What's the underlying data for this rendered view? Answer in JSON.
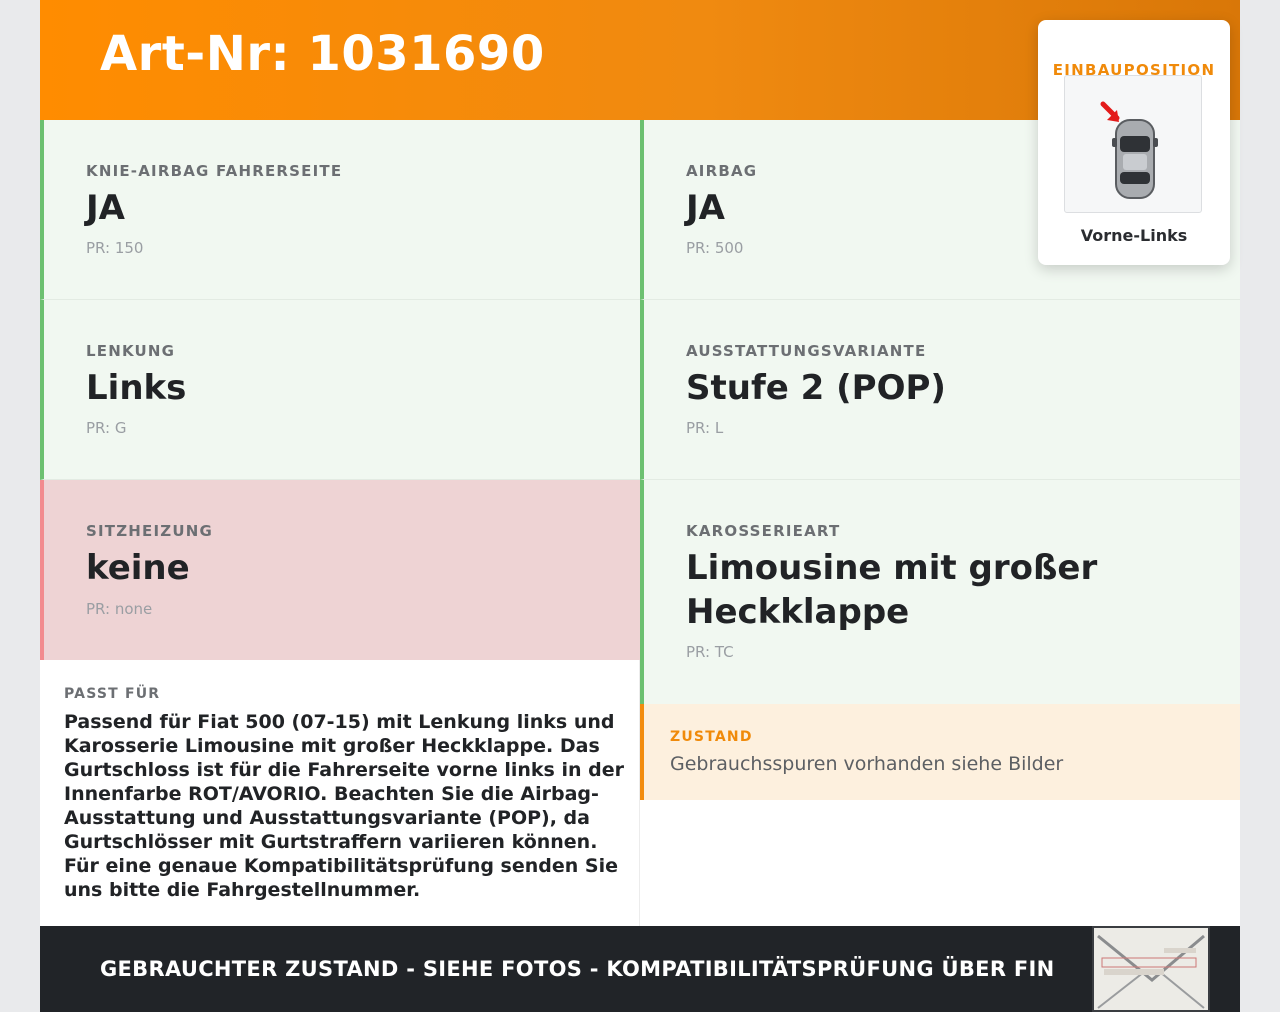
{
  "header": {
    "title": "Art-Nr: 1031690"
  },
  "cells": [
    {
      "label": "KNIE-AIRBAG FAHRERSEITE",
      "value": "JA",
      "pr": "PR: 150"
    },
    {
      "label": "AIRBAG",
      "value": "JA",
      "pr": "PR: 500"
    },
    {
      "label": "LENKUNG",
      "value": "Links",
      "pr": "PR: G"
    },
    {
      "label": "AUSSTATTUNGSVARIANTE",
      "value": "Stufe 2 (POP)",
      "pr": "PR: L"
    },
    {
      "label": "SITZHEIZUNG",
      "value": "keine",
      "pr": "PR: none"
    },
    {
      "label": "KAROSSERIEART",
      "value": "Limousine mit großer Heckklappe",
      "pr": "PR: TC"
    }
  ],
  "fits": {
    "label": "PASST FÜR",
    "text": "Passend für Fiat 500 (07-15) mit Lenkung links und Karosserie Limousine mit großer Heckklappe. Das Gurtschloss ist für die Fahrerseite vorne links in der Innenfarbe ROT/AVORIO. Beachten Sie die Airbag-Ausstattung und Ausstattungsvariante (POP), da Gurtschlösser mit Gurtstraffern variieren können. Für eine genaue Kompatibilitätsprüfung senden Sie uns bitte die Fahrgestellnummer."
  },
  "condition": {
    "label": "ZUSTAND",
    "text": "Gebrauchsspuren vorhanden siehe Bilder"
  },
  "position": {
    "title": "EINBAUPOSITION",
    "caption": "Vorne-Links"
  },
  "footer": {
    "text": "GEBRAUCHTER ZUSTAND - SIEHE FOTOS - KOMPATIBILITÄTSPRÜFUNG ÜBER FIN"
  },
  "colors": {
    "accent": "#ff8c00",
    "ok_border": "#6cc070",
    "bad_border": "#f28b8e",
    "footer_bg": "#212428"
  },
  "icons": {
    "position": "car-top-view-icon",
    "arrow": "red-arrow-icon",
    "thumbnail": "vehicle-document-thumbnail"
  }
}
